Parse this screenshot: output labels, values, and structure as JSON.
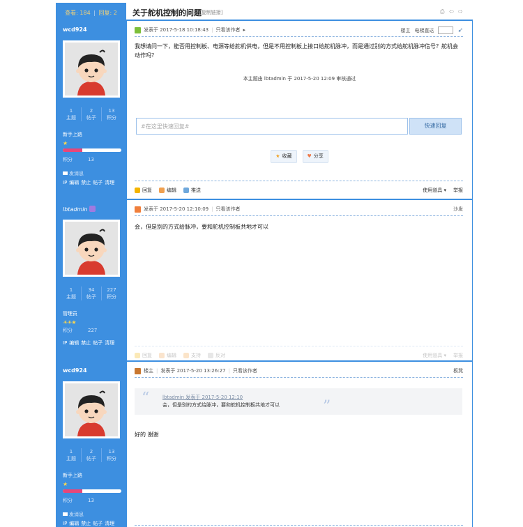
{
  "header": {
    "views_label": "查看:",
    "views": "184",
    "replies_label": "回复:",
    "replies": "2",
    "thread_title": "关于舵机控制的问题",
    "copy_link": "[复制链接]"
  },
  "posts": [
    {
      "author": "wcd924",
      "stats": [
        {
          "value": "1",
          "label": "主题"
        },
        {
          "value": "2",
          "label": "帖子"
        },
        {
          "value": "13",
          "label": "积分"
        }
      ],
      "group": "新手上路",
      "stars": "★",
      "credit_fill_fraction": 0.33,
      "credit_label": "积分",
      "credit_value": "13",
      "pm": "发消息",
      "admin_links": [
        "IP",
        "编辑",
        "禁止",
        "帖子",
        "清理"
      ],
      "meta": {
        "posted": "发表于 2017-5-18 10:18:43",
        "only_author": "只看该作者",
        "arrow": "▸"
      },
      "meta_right": {
        "floor": "楼主",
        "jump": "电梯直达"
      },
      "body": "我想请问一下，能否用控制板、电源等给舵机供电，但是不用控制板上接口给舵机脉冲，而是通过别的方式给舵机脉冲信号？舵机会动作吗？",
      "review_note": "本主题由 lbtadmin 于 2017-5-20 12:09 审核通过",
      "quick_reply_placeholder": "#在这里快速回复#",
      "quick_reply_button": "快速回复",
      "actions": [
        "收藏",
        "分享"
      ],
      "toolbar": {
        "reply": "回复",
        "edit": "编辑",
        "push": "推送",
        "tools": "使用道具",
        "report": "举报"
      }
    },
    {
      "author": "lbtadmin",
      "stats": [
        {
          "value": "1",
          "label": "主题"
        },
        {
          "value": "34",
          "label": "帖子"
        },
        {
          "value": "227",
          "label": "积分"
        }
      ],
      "group": "管理员",
      "stars": "☀☀★",
      "credit_label": "积分",
      "credit_value": "227",
      "admin_links": [
        "IP",
        "编辑",
        "禁止",
        "帖子",
        "清理"
      ],
      "meta": {
        "posted": "发表于 2017-5-20 12:10:09",
        "only_author": "只看该作者"
      },
      "meta_right": {
        "floor": "沙发"
      },
      "body": "会，但是别的方式给脉冲，要和舵机控制板共地才可以",
      "toolbar": {
        "reply": "回复",
        "edit": "编辑",
        "support": "支持",
        "oppose": "反对",
        "tools": "使用道具",
        "report": "举报"
      }
    },
    {
      "author": "wcd924",
      "stats": [
        {
          "value": "1",
          "label": "主题"
        },
        {
          "value": "2",
          "label": "帖子"
        },
        {
          "value": "13",
          "label": "积分"
        }
      ],
      "group": "新手上路",
      "stars": "★",
      "credit_fill_fraction": 0.33,
      "credit_label": "积分",
      "credit_value": "13",
      "pm": "发消息",
      "admin_links": [
        "IP",
        "编辑",
        "禁止",
        "帖子",
        "清理"
      ],
      "meta": {
        "owner": "楼主",
        "posted": "发表于 2017-5-20 13:26:27",
        "only_author": "只看该作者"
      },
      "meta_right": {
        "floor": "板凳"
      },
      "quote_author": "lbtadmin 发表于 2017-5-20 12:10",
      "quote_text": "会，但是别的方式给脉冲，要和舵机控制板共地才可以",
      "body": "好的  谢谢"
    }
  ]
}
